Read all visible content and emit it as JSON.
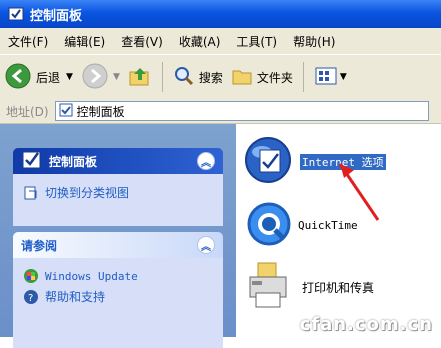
{
  "window": {
    "title": "控制面板"
  },
  "menu": {
    "items": [
      "文件(F)",
      "编辑(E)",
      "查看(V)",
      "收藏(A)",
      "工具(T)",
      "帮助(H)"
    ]
  },
  "toolbar": {
    "back_label": "后退",
    "search_label": "搜索",
    "folders_label": "文件夹"
  },
  "address": {
    "label": "地址(D)",
    "value": "控制面板"
  },
  "sidebar": {
    "panel1": {
      "title": "控制面板",
      "link": "切换到分类视图"
    },
    "panel2": {
      "title": "请参阅",
      "links": [
        "Windows Update",
        "帮助和支持"
      ]
    }
  },
  "items": [
    {
      "label": "Internet 选项",
      "icon": "internet-options-icon"
    },
    {
      "label": "QuickTime",
      "icon": "quicktime-icon"
    },
    {
      "label": "打印机和传真",
      "icon": "printer-fax-icon"
    }
  ],
  "watermark": "cfan.com.cn",
  "colors": {
    "titlebar": "#0a55e0",
    "sidebar": "#6b8fc9",
    "link": "#215dc6",
    "selection": "#316ac5",
    "arrow": "#e02020"
  }
}
